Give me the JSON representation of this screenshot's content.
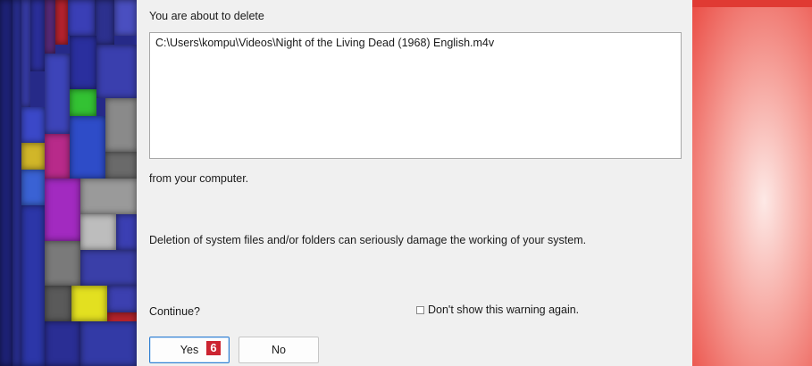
{
  "dialog": {
    "intro_text": "You are about to delete",
    "file_path": "C:\\Users\\kompu\\Videos\\Night of the Living Dead (1968) English.m4v",
    "from_text": "from your computer.",
    "warning_text": "Deletion of system files and/or folders can seriously damage the working of your system.",
    "continue_label": "Continue?",
    "dont_show_label": "Don't show this warning again.",
    "dont_show_checked": false,
    "yes_label": "Yes",
    "no_label": "No",
    "callout_number": "6"
  },
  "colors": {
    "treemap_background": "#262a88",
    "dialog_background": "#f0f0f0",
    "default_button_border": "#2f7fd2",
    "callout_badge": "#cc2431",
    "side_panel": "#ea4b43"
  }
}
